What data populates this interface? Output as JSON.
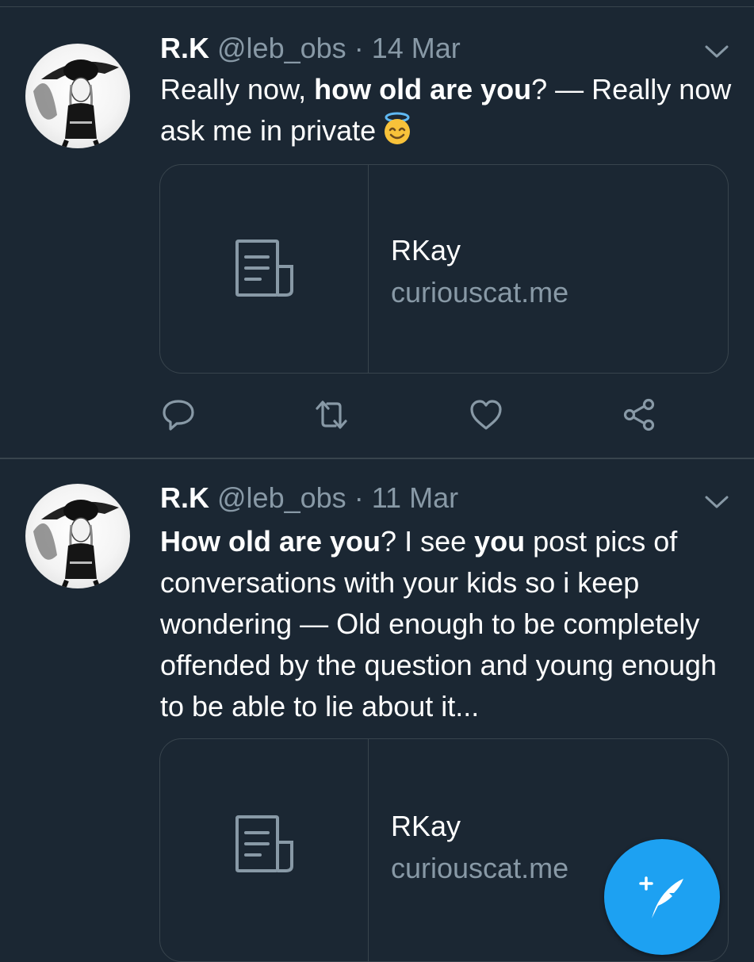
{
  "tweets": [
    {
      "name": "R.K",
      "handle": "@leb_obs",
      "separator": "·",
      "date": "14 Mar",
      "text_parts": [
        "Really now, ",
        "how old are you",
        "? — Really now ask me in private"
      ],
      "card": {
        "title": "RKay",
        "domain": "curiouscat.me"
      }
    },
    {
      "name": "R.K",
      "handle": "@leb_obs",
      "separator": "·",
      "date": "11 Mar",
      "text_parts": [
        "How old are you",
        "? I see ",
        "you",
        " post pics of conversations with your kids so i keep wondering — Old enough to be completely offended by the question and young enough to be able to lie about it..."
      ],
      "card": {
        "title": "RKay",
        "domain": "curiouscat.me"
      }
    }
  ],
  "icons": {
    "avatar": "avatar",
    "caret": "chevron-down-icon",
    "reply": "reply-icon",
    "retweet": "retweet-icon",
    "like": "heart-icon",
    "share": "share-icon",
    "card": "document-icon",
    "emoji": "smiling-face-with-halo-emoji",
    "compose": "compose-tweet-icon"
  },
  "colors": {
    "background": "#1b2733",
    "border": "#38444d",
    "secondary_text": "#8899a6",
    "accent": "#1da1f2"
  }
}
